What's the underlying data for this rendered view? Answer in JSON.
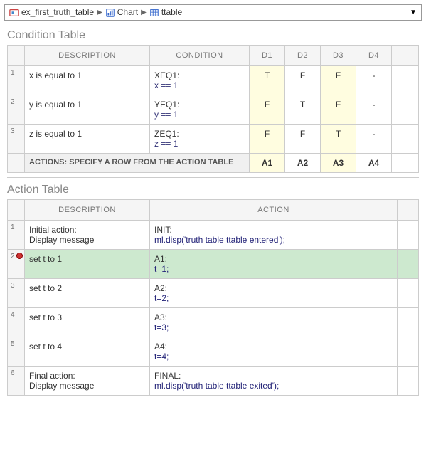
{
  "breadcrumb": {
    "items": [
      {
        "label": "ex_first_truth_table"
      },
      {
        "label": "Chart"
      },
      {
        "label": "ttable"
      }
    ]
  },
  "condition_table": {
    "title": "Condition Table",
    "headers": {
      "description": "DESCRIPTION",
      "condition": "CONDITION",
      "d": [
        "D1",
        "D2",
        "D3",
        "D4"
      ]
    },
    "rows": [
      {
        "num": "1",
        "description": "x is equal to 1",
        "name": "XEQ1:",
        "expr": "x == 1",
        "d": [
          "T",
          "F",
          "F",
          "-"
        ],
        "highlight": [
          true,
          false,
          true,
          false
        ]
      },
      {
        "num": "2",
        "description": "y is equal to 1",
        "name": "YEQ1:",
        "expr": "y == 1",
        "d": [
          "F",
          "T",
          "F",
          "-"
        ],
        "highlight": [
          true,
          false,
          true,
          false
        ]
      },
      {
        "num": "3",
        "description": "z is equal to 1",
        "name": "ZEQ1:",
        "expr": "z == 1",
        "d": [
          "F",
          "F",
          "T",
          "-"
        ],
        "highlight": [
          true,
          false,
          true,
          false
        ]
      }
    ],
    "actions_row": {
      "label": "ACTIONS: SPECIFY A ROW FROM THE ACTION TABLE",
      "a": [
        "A1",
        "A2",
        "A3",
        "A4"
      ],
      "highlight": [
        true,
        false,
        true,
        false
      ]
    }
  },
  "action_table": {
    "title": "Action Table",
    "headers": {
      "description": "DESCRIPTION",
      "action": "ACTION"
    },
    "rows": [
      {
        "num": "1",
        "description_l1": "Initial action:",
        "description_l2": "Display message",
        "name": "INIT:",
        "stmt": "ml.disp('truth table ttable entered');",
        "highlight": false,
        "breakpoint": false
      },
      {
        "num": "2",
        "description_l1": "set t to 1",
        "description_l2": "",
        "name": "A1:",
        "stmt": "t=1;",
        "highlight": true,
        "breakpoint": true
      },
      {
        "num": "3",
        "description_l1": "set t to 2",
        "description_l2": "",
        "name": "A2:",
        "stmt": "t=2;",
        "highlight": false,
        "breakpoint": false
      },
      {
        "num": "4",
        "description_l1": "set t to 3",
        "description_l2": "",
        "name": "A3:",
        "stmt": "t=3;",
        "highlight": false,
        "breakpoint": false
      },
      {
        "num": "5",
        "description_l1": "set t to 4",
        "description_l2": "",
        "name": "A4:",
        "stmt": "t=4;",
        "highlight": false,
        "breakpoint": false
      },
      {
        "num": "6",
        "description_l1": "Final action:",
        "description_l2": "Display message",
        "name": "FINAL:",
        "stmt": "ml.disp('truth table ttable exited');",
        "highlight": false,
        "breakpoint": false
      }
    ]
  }
}
